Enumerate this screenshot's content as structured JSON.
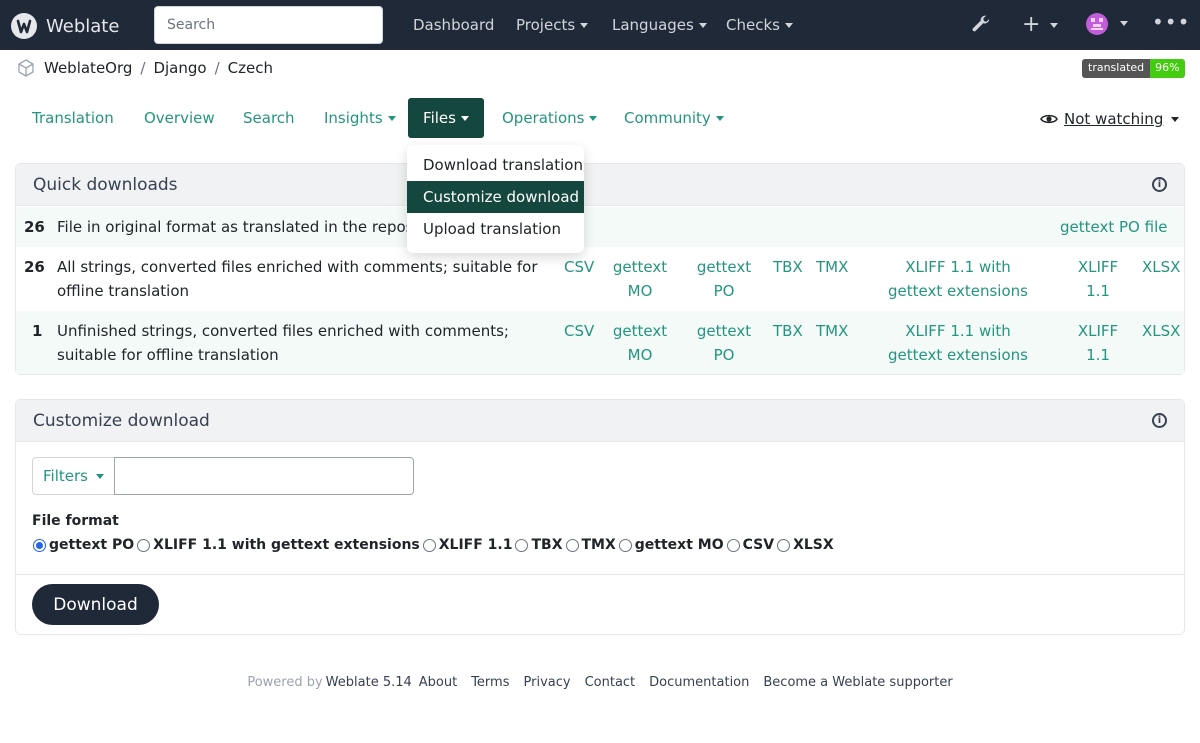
{
  "navbar": {
    "brand": "Weblate",
    "search_placeholder": "Search",
    "links": [
      "Dashboard",
      "Projects",
      "Languages",
      "Checks"
    ]
  },
  "breadcrumb": [
    "WeblateOrg",
    "Django",
    "Czech"
  ],
  "badge": {
    "label": "translated",
    "value": "96%"
  },
  "subnav": {
    "tabs": [
      "Translation",
      "Overview",
      "Search",
      "Insights",
      "Files",
      "Operations",
      "Community"
    ],
    "watch_label": "Not watching"
  },
  "files_menu": {
    "items": [
      "Download translation",
      "Customize download",
      "Upload translation"
    ],
    "active": "Customize download"
  },
  "quick_downloads": {
    "title": "Quick downloads",
    "rows": [
      {
        "count": "26",
        "description": "File in original format as translated in the repository",
        "formats": [
          "gettext PO file"
        ]
      },
      {
        "count": "26",
        "description": "All strings, converted files enriched with comments; suitable for offline translation",
        "formats": [
          "CSV",
          "gettext MO",
          "gettext PO",
          "TBX",
          "TMX",
          "XLIFF 1.1 with gettext extensions",
          "XLIFF 1.1",
          "XLSX"
        ]
      },
      {
        "count": "1",
        "description": "Unfinished strings, converted files enriched with comments; suitable for offline translation",
        "formats": [
          "CSV",
          "gettext MO",
          "gettext PO",
          "TBX",
          "TMX",
          "XLIFF 1.1 with gettext extensions",
          "XLIFF 1.1",
          "XLSX"
        ]
      }
    ]
  },
  "customize": {
    "title": "Customize download",
    "filters_label": "Filters",
    "file_format_label": "File format",
    "formats": [
      "gettext PO",
      "XLIFF 1.1 with gettext extensions",
      "XLIFF 1.1",
      "TBX",
      "TMX",
      "gettext MO",
      "CSV",
      "XLSX"
    ],
    "selected_format": "gettext PO",
    "download_label": "Download"
  },
  "footer": {
    "powered_by": "Powered by",
    "weblate_version": "Weblate 5.14",
    "links": [
      "About",
      "Terms",
      "Privacy",
      "Contact",
      "Documentation",
      "Become a Weblate supporter"
    ]
  },
  "colors": {
    "navbar": "#1f2937",
    "accent": "#24957f",
    "active_tab": "#14473d",
    "badge_value": "#44cc11"
  }
}
